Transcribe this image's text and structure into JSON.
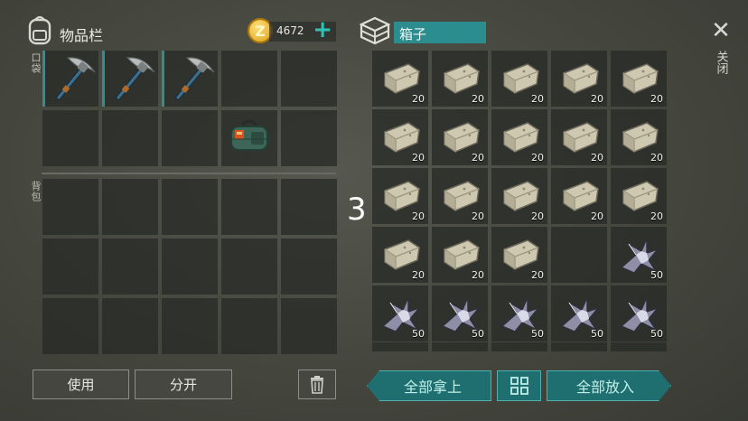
{
  "inventory": {
    "title": "物品栏",
    "pocket_label": "口袋",
    "backpack_label": "背包",
    "coins": "4672",
    "coin_symbol": "Z",
    "add_symbol": "+"
  },
  "box": {
    "title": "箱子",
    "close_label": "关闭",
    "close_symbol": "✕",
    "marker": "3"
  },
  "buttons": {
    "use": "使用",
    "split": "分开",
    "take_all": "全部拿上",
    "put_all": "全部放入"
  },
  "pocket_slots": [
    "pickaxe",
    "pickaxe",
    "pickaxe",
    "",
    "",
    "",
    "",
    "",
    "toolbag",
    ""
  ],
  "box_slots": [
    {
      "item": "stone",
      "count": "20"
    },
    {
      "item": "stone",
      "count": "20"
    },
    {
      "item": "stone",
      "count": "20"
    },
    {
      "item": "stone",
      "count": "20"
    },
    {
      "item": "stone",
      "count": "20"
    },
    {
      "item": "stone",
      "count": "20"
    },
    {
      "item": "stone",
      "count": "20"
    },
    {
      "item": "stone",
      "count": "20"
    },
    {
      "item": "stone",
      "count": "20"
    },
    {
      "item": "stone",
      "count": "20"
    },
    {
      "item": "stone",
      "count": "20"
    },
    {
      "item": "stone",
      "count": "20"
    },
    {
      "item": "stone",
      "count": "20"
    },
    {
      "item": "stone",
      "count": "20"
    },
    {
      "item": "stone",
      "count": "20"
    },
    {
      "item": "stone",
      "count": "20"
    },
    {
      "item": "stone",
      "count": "20"
    },
    {
      "item": "stone",
      "count": "20"
    },
    {
      "item": "",
      "count": ""
    },
    {
      "item": "metal",
      "count": "50"
    },
    {
      "item": "metal",
      "count": "50"
    },
    {
      "item": "metal",
      "count": "50"
    },
    {
      "item": "metal",
      "count": "50"
    },
    {
      "item": "metal",
      "count": "50"
    },
    {
      "item": "metal",
      "count": "50"
    }
  ],
  "colors": {
    "accent": "#2f8f8a",
    "coin": "#e8b425",
    "teal_button": "#1f6e70"
  }
}
